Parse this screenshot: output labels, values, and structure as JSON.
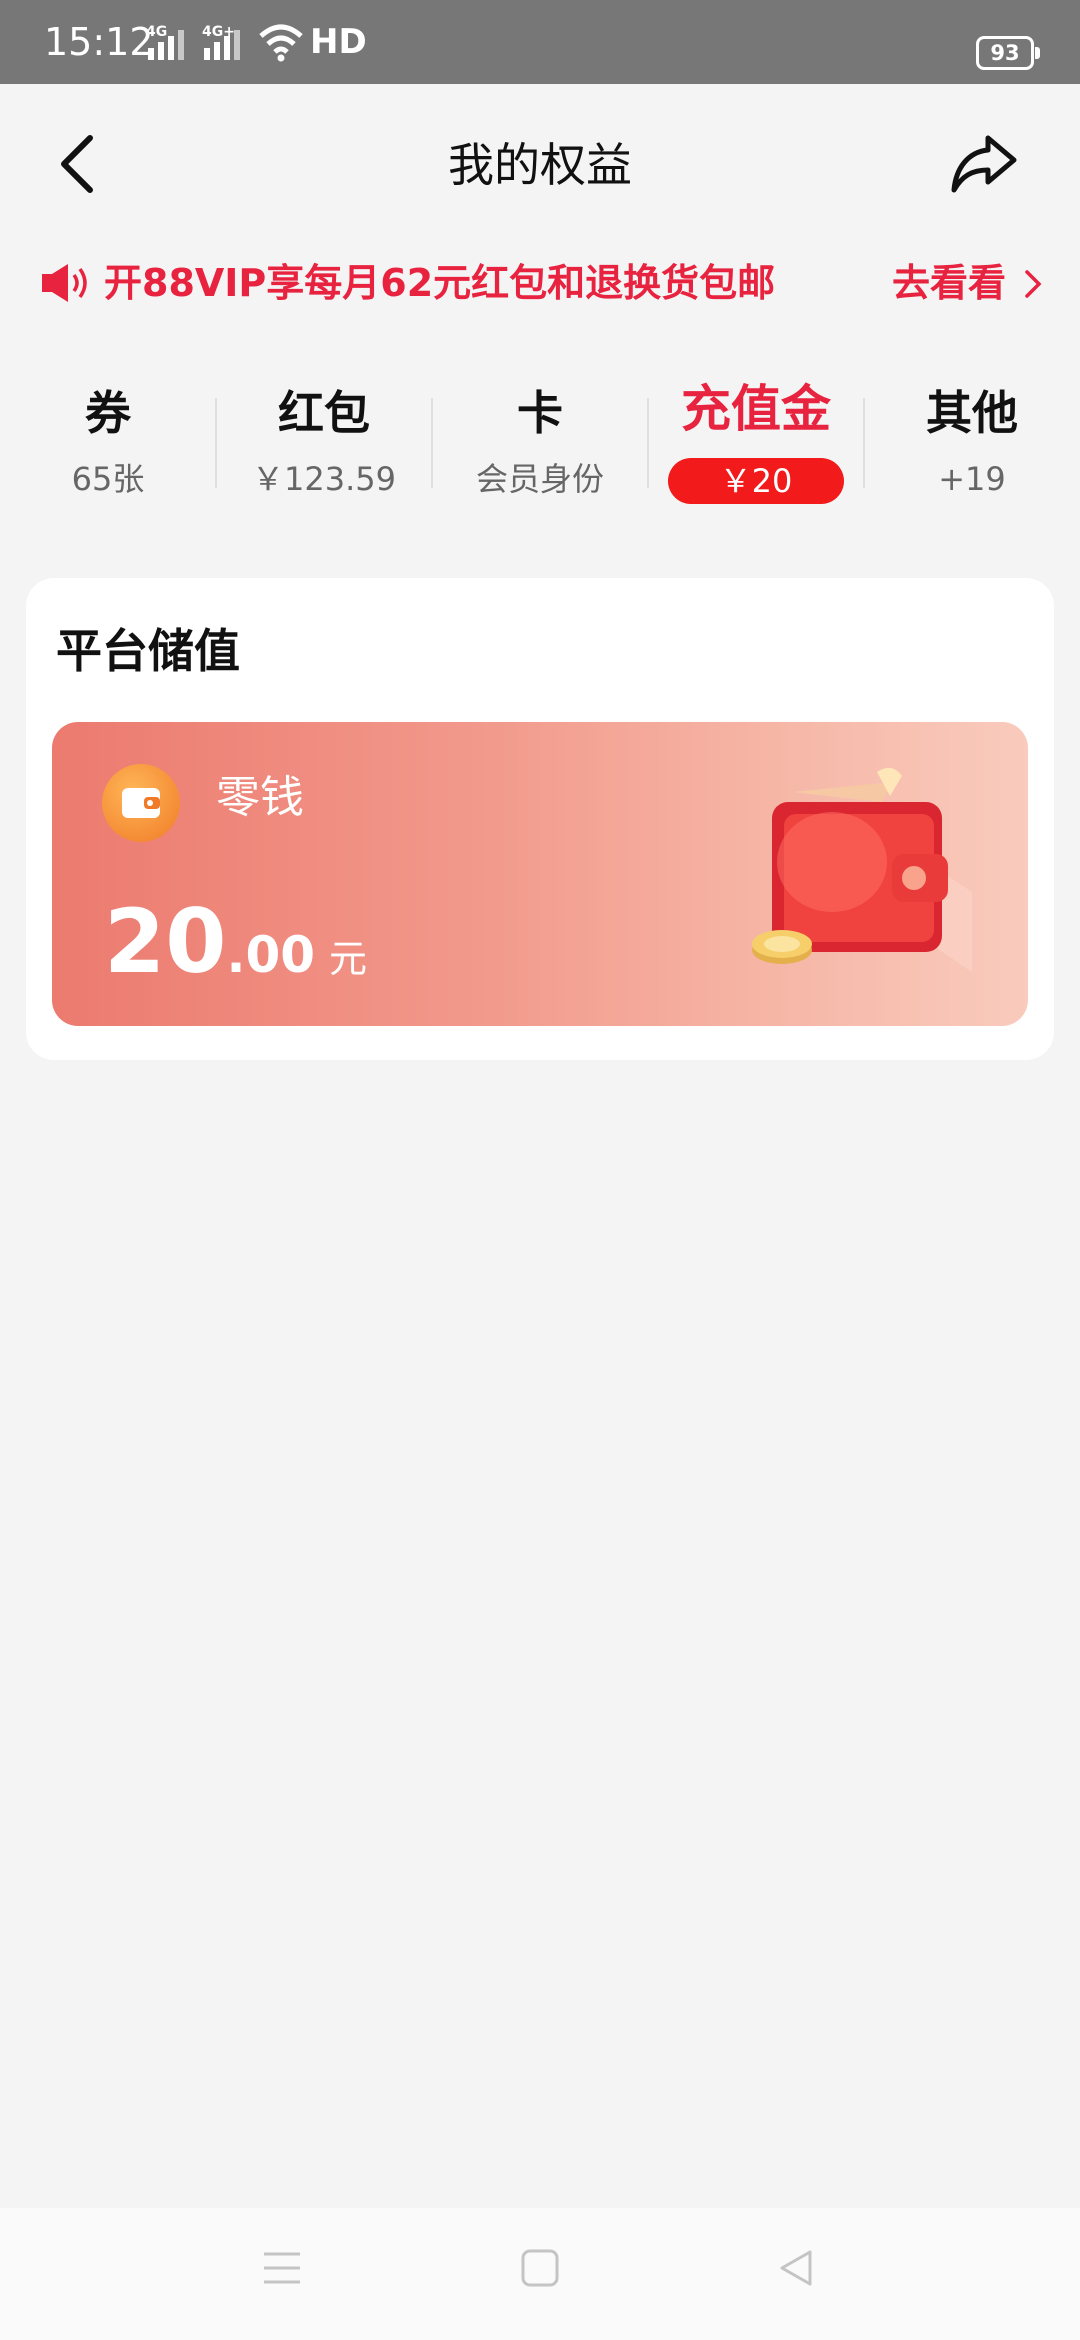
{
  "status_bar": {
    "time": "15:12",
    "network_1": "4G",
    "network_2": "4G+",
    "hd": "HD",
    "battery": "93"
  },
  "header": {
    "title": "我的权益"
  },
  "promo": {
    "text": "开88VIP享每月62元红包和退换货包邮",
    "action": "去看看"
  },
  "tabs": [
    {
      "label": "券",
      "sub": "65张"
    },
    {
      "label": "红包",
      "sub": "￥123.59"
    },
    {
      "label": "卡",
      "sub": "会员身份"
    },
    {
      "label": "充值金",
      "sub": "￥20",
      "active": true
    },
    {
      "label": "其他",
      "sub": "+19"
    }
  ],
  "section": {
    "title": "平台储值",
    "wallet": {
      "name": "零钱",
      "amount_int": "20",
      "amount_dec": ".00",
      "unit": "元"
    }
  },
  "icons": {
    "back": "back-arrow-icon",
    "share": "share-icon",
    "speaker": "speaker-icon",
    "chevron": "chevron-right-icon",
    "nav_menu": "menu-icon",
    "nav_home": "home-square-icon",
    "nav_back": "back-triangle-icon"
  },
  "colors": {
    "accent": "#e8233f",
    "active_badge": "#f21a1a",
    "status_bar": "#777777",
    "page_bg": "#f4f4f4"
  }
}
